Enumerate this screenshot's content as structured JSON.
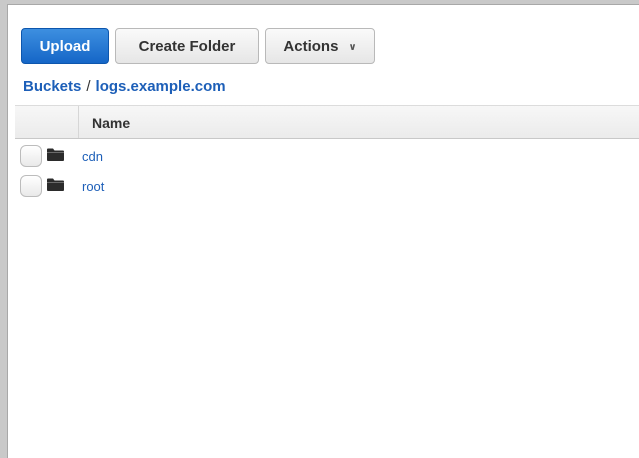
{
  "toolbar": {
    "upload_label": "Upload",
    "create_folder_label": "Create Folder",
    "actions_label": "Actions",
    "actions_chevron": "∨"
  },
  "breadcrumb": {
    "root_label": "Buckets",
    "separator": "/",
    "current_label": "logs.example.com"
  },
  "table": {
    "column_name": "Name",
    "rows": [
      {
        "name": "cdn",
        "icon": "folder-icon"
      },
      {
        "name": "root",
        "icon": "folder-icon"
      }
    ]
  },
  "colors": {
    "primary": "#1566c7",
    "link": "#1d5fb8"
  }
}
